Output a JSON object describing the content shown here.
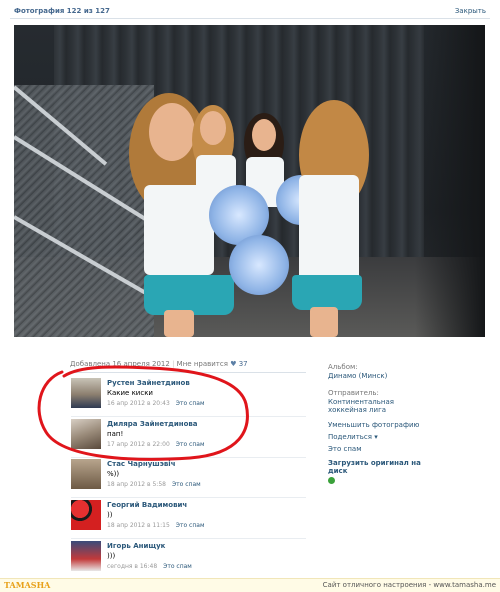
{
  "header": {
    "title": "Фотография 122 из 127",
    "close": "Закрыть"
  },
  "meta": {
    "added": "Добавлена 16 апреля 2012",
    "like_label": "Мне нравится",
    "like_count": "37"
  },
  "comments": [
    {
      "name": "Рустен Зайнетдинов",
      "text": "Какие киски",
      "date": "16 апр 2012 в 20:43",
      "spam": "Это спам"
    },
    {
      "name": "Диляра Зайнетдинова",
      "text": "пап!",
      "date": "17 апр 2012 в 22:00",
      "spam": "Это спам"
    },
    {
      "name": "Стас Чарнушэвіч",
      "text": "%))",
      "date": "18 апр 2012 в 5:58",
      "spam": "Это спам"
    },
    {
      "name": "Георгий Вадимович",
      "text": "))",
      "date": "18 апр 2012 в 11:15",
      "spam": "Это спам"
    },
    {
      "name": "Игорь Анищук",
      "text": ")))",
      "date": "сегодня в 16:48",
      "spam": "Это спам"
    }
  ],
  "sidebar": {
    "album_label": "Альбом:",
    "album": "Динамо (Минск)",
    "sender_label": "Отправитель:",
    "sender": "Континентальная хоккейная лига",
    "reduce": "Уменьшить фотографию",
    "share": "Поделиться ▾",
    "spam": "Это спам",
    "download": "Загрузить оригинал на диск"
  },
  "footer": {
    "logo": "TAMASHA",
    "slogan": "Сайт отличного настроения - www.tamasha.me"
  },
  "colors": {
    "link": "#2b587a",
    "title": "#45688e",
    "annotation": "#e0151b",
    "accent": "#2aa6b4"
  }
}
